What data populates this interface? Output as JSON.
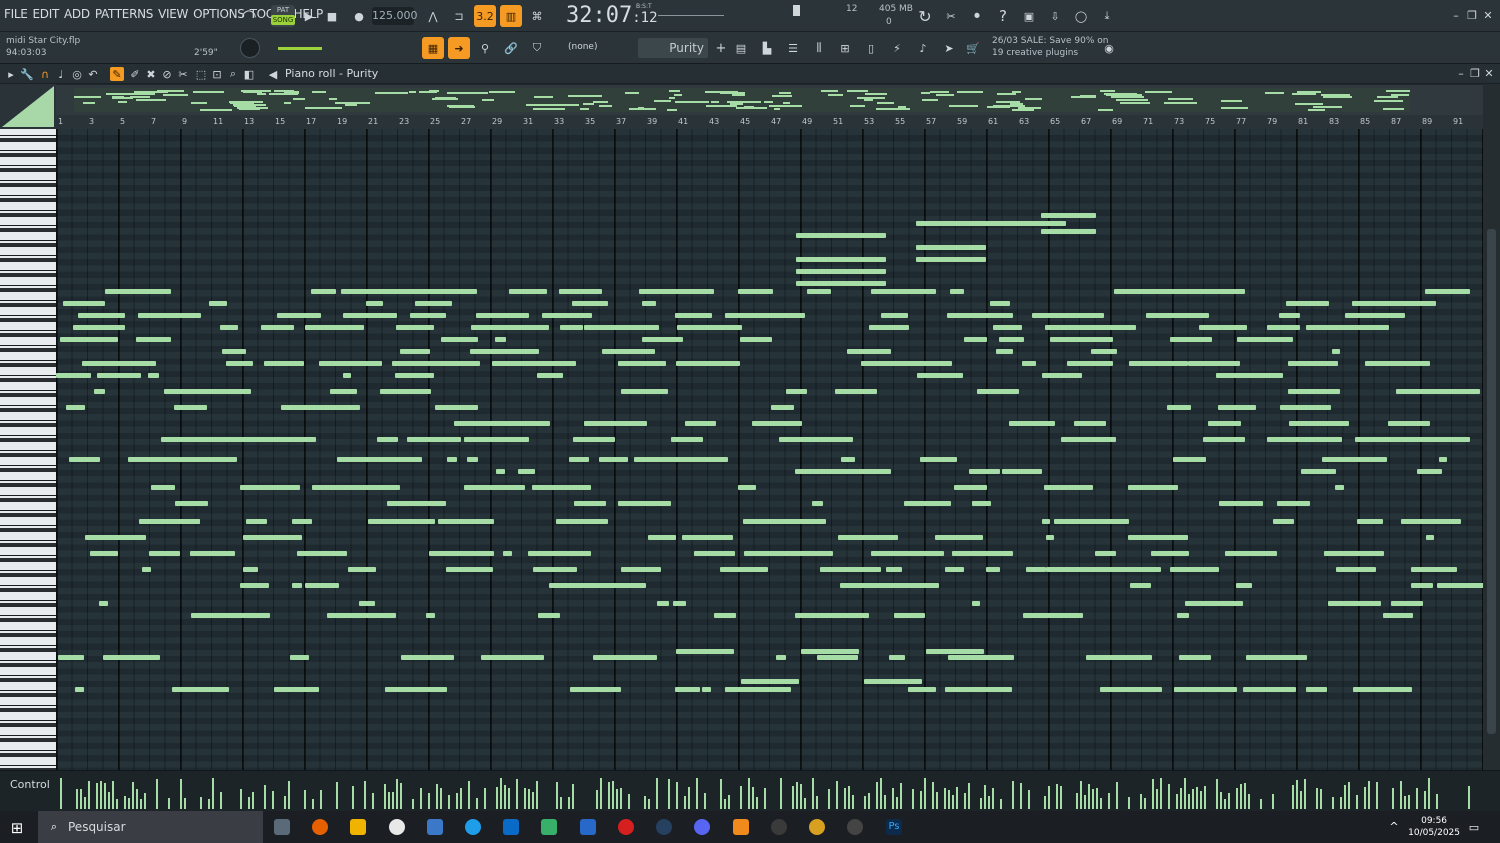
{
  "menu": [
    "FILE",
    "EDIT",
    "ADD",
    "PATTERNS",
    "VIEW",
    "OPTIONS",
    "TOOLS",
    "HELP"
  ],
  "transport": {
    "mode_pat": "PAT",
    "mode_song": "SONG",
    "tempo": "125.000",
    "time_main": "32:07",
    "time_sub": "12",
    "time_unit": "B:S:T"
  },
  "pattern_toggle": "3.2",
  "system": {
    "cpu": "12",
    "memory": "405 MB",
    "voices": "0"
  },
  "project": {
    "file": "midi Star City.flp",
    "position": "94:03:03",
    "length": "2'59\""
  },
  "channel_selector": "(none)",
  "pattern_name": "Purity",
  "news": {
    "line1": "26/03  SALE: Save 90% on",
    "line2": "19 creative plugins"
  },
  "piano_roll": {
    "title": "Piano roll - Purity"
  },
  "ruler": [
    "1",
    "3",
    "5",
    "7",
    "9",
    "11",
    "13",
    "15",
    "17",
    "19",
    "21",
    "23",
    "25",
    "27",
    "29",
    "31",
    "33",
    "35",
    "37",
    "39",
    "41",
    "43",
    "45",
    "47",
    "49",
    "51",
    "53",
    "55",
    "57",
    "59",
    "61",
    "63",
    "65",
    "67",
    "69",
    "71",
    "73",
    "75",
    "77",
    "79",
    "81",
    "83",
    "85",
    "87",
    "89",
    "91"
  ],
  "control": {
    "label": "Control"
  },
  "taskbar": {
    "search_placeholder": "Pesquisar",
    "time": "09:56",
    "date": "10/05/2025"
  },
  "colors": {
    "note": "#a6dda6",
    "accent": "#f59a23",
    "song_mode": "#9bd23c"
  }
}
